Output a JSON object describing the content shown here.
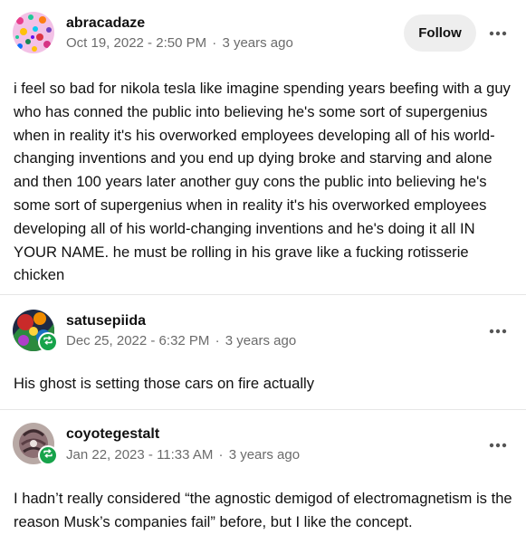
{
  "posts": [
    {
      "username": "abracadaze",
      "date": "Oct 19, 2022 - 2:50 PM",
      "separator": "·",
      "relative": "3 years ago",
      "follow_label": "Follow",
      "more_icon": "more-horizontal-icon",
      "body": "i feel so bad for nikola tesla like imagine spending years beefing with a guy who has conned the public into believing he's some sort of supergenius when in reality it's his overworked employees developing all of his world-changing inventions and you end up dying broke and starving and alone and then 100 years later another guy cons the public into believing he's some sort of supergenius when in reality it's his overworked employees developing all of his world-changing inventions and he's doing it all IN YOUR NAME. he must be rolling in his grave like a fucking rotisserie chicken"
    },
    {
      "username": "satusepiida",
      "date": "Dec 25, 2022 - 6:32 PM",
      "separator": "·",
      "relative": "3 years ago",
      "more_icon": "more-horizontal-icon",
      "badge_icon": "reblog-icon",
      "body": "His ghost is setting those cars on fire actually"
    },
    {
      "username": "coyotegestalt",
      "date": "Jan 22, 2023 - 11:33 AM",
      "separator": "·",
      "relative": "3 years ago",
      "more_icon": "more-horizontal-icon",
      "badge_icon": "reblog-icon",
      "body": "I hadn’t really considered “the agnostic demigod of electromagnetism is the reason Musk’s companies fail” before, but I like the concept."
    }
  ],
  "colors": {
    "badge": "#16a34a",
    "meta_text": "#6b6b6b",
    "follow_bg": "#eeeeee",
    "divider": "#e6e6e6"
  }
}
